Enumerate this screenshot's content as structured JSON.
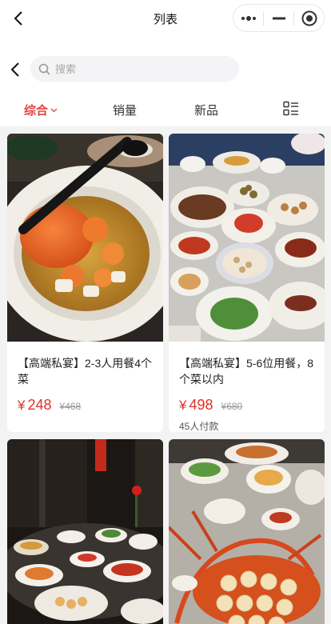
{
  "navbar": {
    "title": "列表"
  },
  "search": {
    "placeholder": "搜索"
  },
  "tabs": [
    {
      "label": "综合",
      "active": true
    },
    {
      "label": "销量",
      "active": false
    },
    {
      "label": "新品",
      "active": false
    }
  ],
  "colors": {
    "accent": "#e1453f",
    "price": "#e0302a"
  },
  "products": [
    {
      "title": "【高端私宴】2-3人用餐4个菜",
      "currency": "¥",
      "price": "248",
      "original_price": "¥468",
      "sold": ""
    },
    {
      "title": "【高端私宴】5-6位用餐，8个菜以内",
      "currency": "¥",
      "price": "498",
      "original_price": "¥680",
      "sold": "45人付款"
    },
    {
      "title": "",
      "currency": "",
      "price": "",
      "original_price": "",
      "sold": ""
    },
    {
      "title": "",
      "currency": "",
      "price": "",
      "original_price": "",
      "sold": ""
    }
  ],
  "icons": {
    "back": "back-arrow-icon",
    "more": "more-dots-icon",
    "minimize": "minimize-icon",
    "close": "close-target-icon",
    "search": "search-icon",
    "sort_arrow": "chevron-down-icon",
    "view_toggle": "list-view-icon"
  }
}
